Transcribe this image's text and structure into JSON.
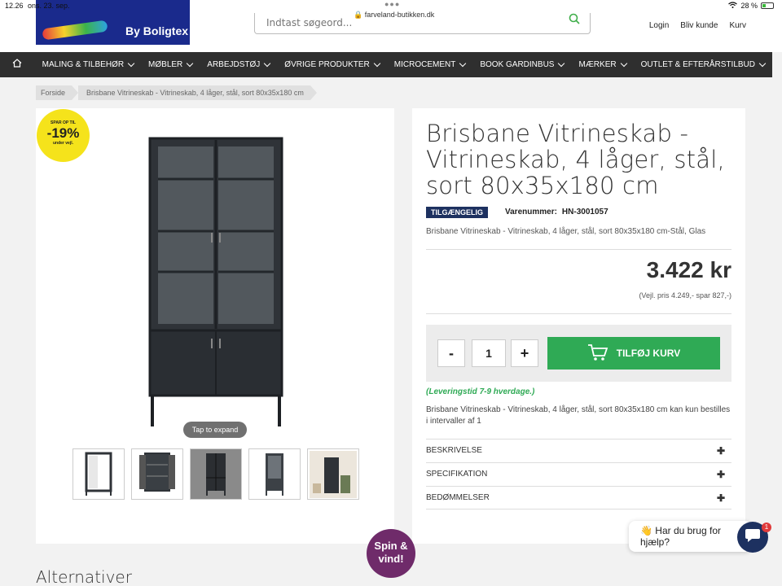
{
  "status": {
    "time": "12.26",
    "date": "ons. 23. sep.",
    "battery": "28 %"
  },
  "browser": {
    "url": "farveland-butikken.dk"
  },
  "header": {
    "logo_text": "By Boligtex",
    "search_placeholder": "Indtast søgeord...",
    "links": [
      "Login",
      "Bliv kunde",
      "Kurv"
    ]
  },
  "nav": {
    "items": [
      "MALING & TILBEHØR",
      "MØBLER",
      "ARBEJDSTØJ",
      "ØVRIGE PRODUKTER",
      "MICROCEMENT",
      "BOOK GARDINBUS",
      "MÆRKER",
      "OUTLET & EFTERÅRSTILBUD"
    ]
  },
  "breadcrumb": [
    "Forside",
    "Brisbane Vitrineskab - Vitrineskab, 4 låger, stål, sort 80x35x180 cm"
  ],
  "badge": {
    "line1": "SPAR OP TIL",
    "discount": "-19%",
    "line2": "under vejl."
  },
  "gallery": {
    "tap_label": "Tap to expand",
    "active_thumb": 2
  },
  "product": {
    "title": "Brisbane Vitrineskab - Vitrineskab, 4 låger, stål, sort 80x35x180 cm",
    "availability": "TILGÆNGELIG",
    "sku_label": "Varenummer:",
    "sku": "HN-3001057",
    "subdesc": "Brisbane Vitrineskab - Vitrineskab, 4 låger, stål, sort 80x35x180 cm-Stål, Glas",
    "price": "3.422 kr",
    "vejl": "(Vejl. pris 4.249,- spar 827,-)",
    "quantity": "1",
    "minus": "-",
    "plus": "+",
    "add_to_cart": "TILFØJ KURV",
    "delivery": "(Leveringstid 7-9 hverdage.)",
    "note": "Brisbane Vitrineskab - Vitrineskab, 4 låger, stål, sort 80x35x180 cm kan kun bestilles i intervaller af 1",
    "accordions": [
      "BESKRIVELSE",
      "SPECIFIKATION",
      "BEDØMMELSER"
    ]
  },
  "floating": {
    "spin_line1": "Spin &",
    "spin_line2": "vind!",
    "chat_text": "👋 Har du brug for hjælp?",
    "chat_count": "1"
  },
  "section": {
    "alternatives": "Alternativer"
  },
  "colors": {
    "nav_bg": "#2f2f2f",
    "accent_green": "#2faa55",
    "badge_yellow": "#f5e31b",
    "spin_purple": "#6f2b6a",
    "navy": "#1d3160"
  }
}
